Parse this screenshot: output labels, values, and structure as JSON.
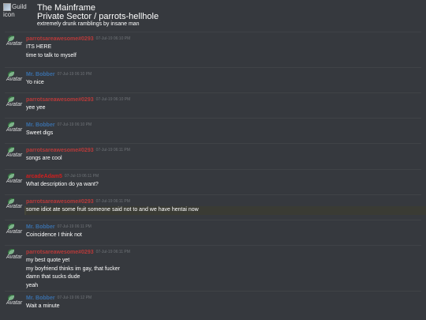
{
  "header": {
    "icon_alt": "Guild icon",
    "guild_name": "The Mainframe",
    "channel": "Private Sector / parrots-hellhole",
    "topic": "extremely drunk ramblings by insane man"
  },
  "avatar_alt": "Avatar",
  "colors": {
    "background": "#36393e",
    "author_red": "#b83a3a",
    "author_blue": "#3a6fa8",
    "author_brightred": "#d11f1f",
    "timestamp": "#6f7378"
  },
  "messages": [
    {
      "author": "parrotsareawesome#0293",
      "color": "#b83a3a",
      "time": "07-Jul-19 06:10 PM",
      "lines": [
        "ITS HERE",
        "time to talk to myself"
      ]
    },
    {
      "author": "Mr. Bobber",
      "color": "#3a6fa8",
      "time": "07-Jul-19 06:10 PM",
      "lines": [
        "Yo nice"
      ]
    },
    {
      "author": "parrotsareawesome#0293",
      "color": "#b83a3a",
      "time": "07-Jul-19 06:10 PM",
      "lines": [
        "yee yee"
      ]
    },
    {
      "author": "Mr. Bobber",
      "color": "#3a6fa8",
      "time": "07-Jul-19 06:10 PM",
      "lines": [
        "Sweet digs"
      ]
    },
    {
      "author": "parrotsareawesome#0293",
      "color": "#b83a3a",
      "time": "07-Jul-19 06:11 PM",
      "lines": [
        "songs are cool"
      ]
    },
    {
      "author": "arcadeAdam5",
      "color": "#d11f1f",
      "time": "07-Jul-19 06:11 PM",
      "lines": [
        "What description do ya want?"
      ]
    },
    {
      "author": "parrotsareawesome#0293",
      "color": "#b83a3a",
      "time": "07-Jul-19 06:11 PM",
      "lines": [
        "some idiot ate some fruit someone said not to and we have hentai now"
      ]
    },
    {
      "author": "Mr. Bobber",
      "color": "#3a6fa8",
      "time": "07-Jul-19 06:11 PM",
      "lines": [
        "Coincidence I think not"
      ]
    },
    {
      "author": "parrotsareawesome#0293",
      "color": "#b83a3a",
      "time": "07-Jul-19 06:11 PM",
      "lines": [
        "my best quote yet",
        "my boyfriend thinks im gay, that fucker",
        "damn that sucks dude",
        "yeah"
      ]
    },
    {
      "author": "Mr. Bobber",
      "color": "#3a6fa8",
      "time": "07-Jul-19 06:12 PM",
      "lines": [
        "Wait a minute"
      ]
    }
  ]
}
